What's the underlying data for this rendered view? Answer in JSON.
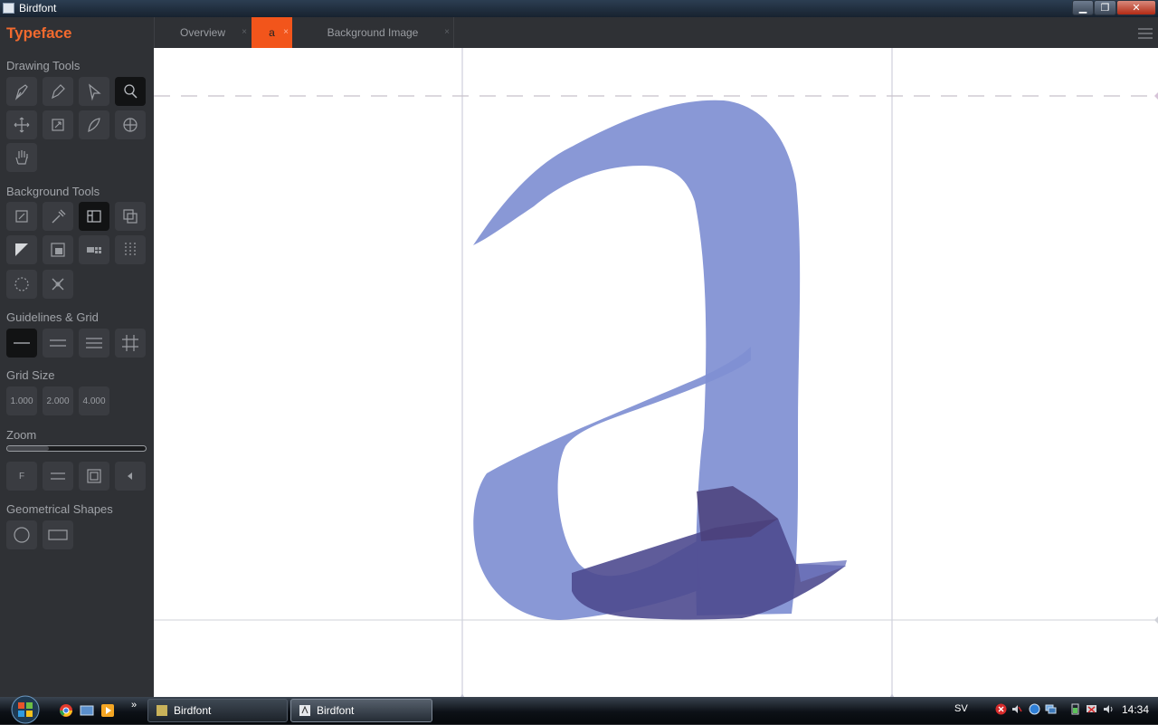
{
  "window": {
    "title": "Birdfont",
    "min_label": "▁",
    "max_label": "❐",
    "close_label": "✕"
  },
  "sidebar": {
    "brand": "Typeface",
    "sections": {
      "drawing": "Drawing Tools",
      "background": "Background Tools",
      "guidelines": "Guidelines & Grid",
      "grid_size": "Grid Size",
      "zoom": "Zoom",
      "shapes": "Geometrical Shapes"
    },
    "grid_sizes": [
      "1.000",
      "2.000",
      "4.000"
    ],
    "zoom_label": "F",
    "zoom_level": 0.3
  },
  "tabs": [
    {
      "label": "Overview",
      "close": "×"
    },
    {
      "label": "a",
      "close": "×"
    },
    {
      "label": "Background Image",
      "close": "×"
    }
  ],
  "taskbar": {
    "buttons": [
      {
        "label": "Birdfont"
      },
      {
        "label": "Birdfont"
      }
    ],
    "overflow": "»",
    "lang": "SV",
    "clock": "14:34"
  },
  "colors": {
    "accent": "#f2551b",
    "brand": "#f26a2e",
    "glyph": "#7f8fd2"
  }
}
